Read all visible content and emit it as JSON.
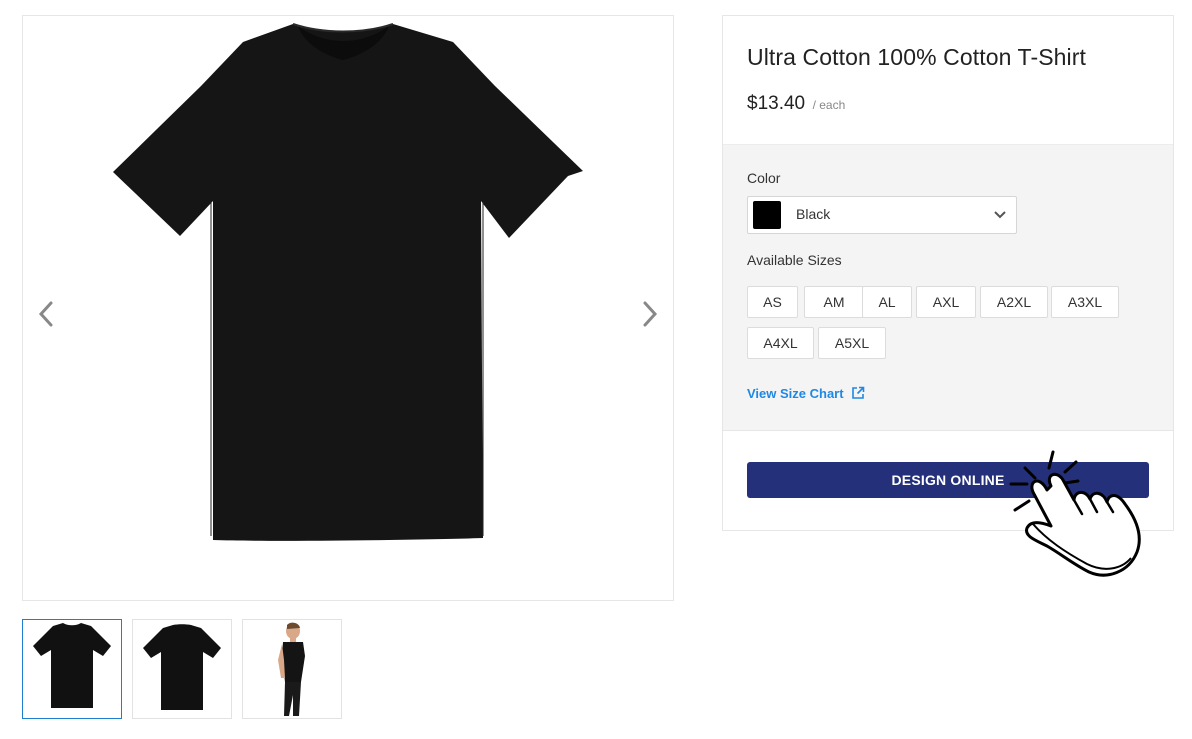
{
  "product": {
    "title": "Ultra Cotton 100% Cotton T-Shirt",
    "price": "$13.40",
    "price_unit": "/ each"
  },
  "gallery": {
    "prev_icon": "chevron-left-icon",
    "next_icon": "chevron-right-icon",
    "thumbnails": [
      "front",
      "back",
      "model-side"
    ],
    "active_index": 0
  },
  "color": {
    "label": "Color",
    "selected": "Black",
    "swatch": "#000000"
  },
  "sizes": {
    "label": "Available Sizes",
    "options": [
      "AS",
      "AM",
      "AL",
      "AXL",
      "A2XL",
      "A3XL",
      "A4XL",
      "A5XL"
    ]
  },
  "size_chart": {
    "label": "View Size Chart",
    "icon": "external-link-icon"
  },
  "cta": {
    "label": "DESIGN ONLINE",
    "color": "#24317a"
  },
  "colors": {
    "link": "#1e88e5",
    "active_thumb_border": "#1e7fd0",
    "options_bg": "#f4f4f4"
  }
}
